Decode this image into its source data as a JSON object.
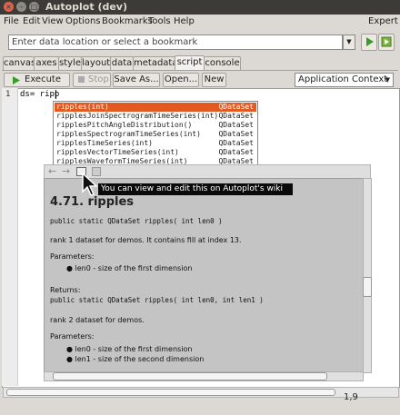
{
  "window": {
    "title": "Autoplot (dev)"
  },
  "menu": {
    "items": [
      "File",
      "Edit",
      "View",
      "Options",
      "Bookmarks",
      "Tools",
      "Help"
    ],
    "right": "Expert"
  },
  "address": {
    "placeholder": "Enter data location or select a bookmark"
  },
  "tabs": [
    "canvas",
    "axes",
    "style",
    "layout",
    "data",
    "metadata",
    "script",
    "console"
  ],
  "active_tab": "script",
  "toolbar": {
    "execute": "Execute",
    "stop": "Stop",
    "save_as": "Save As...",
    "open": "Open...",
    "new": "New",
    "context": "Application Context"
  },
  "editor": {
    "line_number": "1",
    "code": "ds= ripp",
    "cursor_position": "1,9"
  },
  "completion": {
    "items": [
      {
        "name": "ripples(int)",
        "type": "QDataSet",
        "selected": true
      },
      {
        "name": "ripplesJoinSpectrogramTimeSeries(int)",
        "type": "QDataSet"
      },
      {
        "name": "ripplesPitchAngleDistribution()",
        "type": "QDataSet"
      },
      {
        "name": "ripplesSpectrogramTimeSeries(int)",
        "type": "QDataSet"
      },
      {
        "name": "ripplesTimeSeries(int)",
        "type": "QDataSet"
      },
      {
        "name": "ripplesVectorTimeSeries(int)",
        "type": "QDataSet"
      },
      {
        "name": "ripplesWaveformTimeSeries(int)",
        "type": "QDataSet"
      }
    ]
  },
  "tooltip": "You can view and edit this on Autoplot's wiki",
  "help": {
    "heading": "4.71. ripples",
    "sig1": "public static QDataSet ripples( int len0 )",
    "desc1": "rank 1 dataset for demos. It contains fill at index 13.",
    "params1_label": "Parameters:",
    "params1": [
      "len0 - size of the first dimension"
    ],
    "returns_label": "Returns:",
    "sig2": "public static QDataSet ripples( int len0, int len1 )",
    "desc2": "rank 2 dataset for demos.",
    "params2_label": "Parameters:",
    "params2": [
      "len0 - size of the first dimension",
      "len1 - size of the second dimension"
    ]
  },
  "colors": {
    "selection": "#e35a20",
    "titlebar": "#3c3b37",
    "help_bg": "#c4c4c4"
  }
}
